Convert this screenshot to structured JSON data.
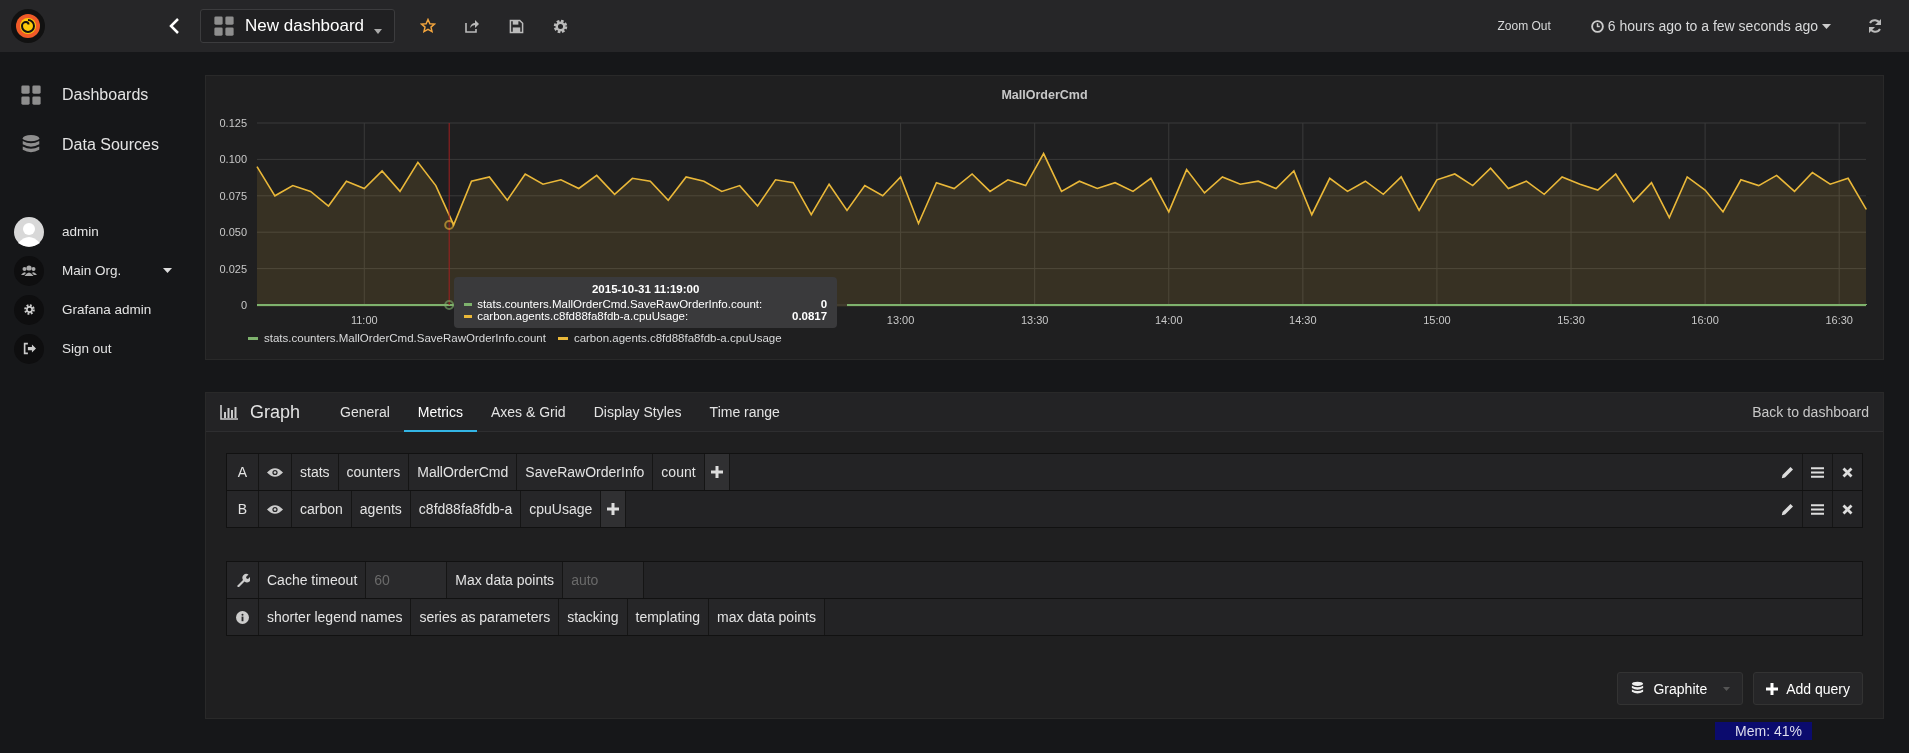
{
  "top_bar": {
    "dashboard_title": "New dashboard",
    "zoom_out": "Zoom Out",
    "time_range": "6 hours ago to a few seconds ago"
  },
  "sidebar": {
    "nav": [
      {
        "label": "Dashboards",
        "kind": "dashboards"
      },
      {
        "label": "Data Sources",
        "kind": "datasources"
      }
    ],
    "user": [
      {
        "label": "admin",
        "kind": "avatar"
      },
      {
        "label": "Main Org.",
        "kind": "org"
      },
      {
        "label": "Grafana admin",
        "kind": "admin"
      },
      {
        "label": "Sign out",
        "kind": "signout"
      }
    ]
  },
  "panel": {
    "title": "MallOrderCmd",
    "chart_data": {
      "type": "area",
      "grid": true,
      "xlim": [
        636,
        996
      ],
      "ylim": [
        0,
        0.125
      ],
      "xticks": [
        {
          "value": 660,
          "label": "11:00"
        },
        {
          "value": 780,
          "label": "13:00"
        },
        {
          "value": 810,
          "label": "13:30"
        },
        {
          "value": 840,
          "label": "14:00"
        },
        {
          "value": 870,
          "label": "14:30"
        },
        {
          "value": 900,
          "label": "15:00"
        },
        {
          "value": 930,
          "label": "15:30"
        },
        {
          "value": 960,
          "label": "16:00"
        },
        {
          "value": 990,
          "label": "16:30"
        }
      ],
      "yticks": [
        {
          "value": 0,
          "label": "0"
        },
        {
          "value": 0.025,
          "label": "0.025"
        },
        {
          "value": 0.05,
          "label": "0.050"
        },
        {
          "value": 0.075,
          "label": "0.075"
        },
        {
          "value": 0.1,
          "label": "0.100"
        },
        {
          "value": 0.125,
          "label": "0.125"
        }
      ],
      "x": [
        636,
        640,
        644,
        648,
        652,
        656,
        660,
        664,
        668,
        672,
        676,
        680,
        684,
        688,
        692,
        696,
        700,
        704,
        708,
        712,
        716,
        720,
        724,
        728,
        732,
        736,
        740,
        744,
        748,
        752,
        756,
        760,
        764,
        768,
        772,
        776,
        780,
        784,
        788,
        792,
        796,
        800,
        804,
        808,
        812,
        816,
        820,
        824,
        828,
        832,
        836,
        840,
        844,
        848,
        852,
        856,
        860,
        864,
        868,
        872,
        876,
        880,
        884,
        888,
        892,
        896,
        900,
        904,
        908,
        912,
        916,
        920,
        924,
        928,
        932,
        936,
        940,
        944,
        948,
        952,
        956,
        960,
        964,
        968,
        972,
        976,
        980,
        984,
        988,
        992,
        996
      ],
      "series": [
        {
          "name": "stats.counters.MallOrderCmd.SaveRawOrderInfo.count",
          "color": "#7eb26d",
          "values": [
            0,
            0,
            0,
            0,
            0,
            0,
            0,
            0,
            0,
            0,
            0,
            0,
            null,
            null,
            null,
            null,
            null,
            null,
            null,
            null,
            null,
            null,
            null,
            null,
            null,
            null,
            null,
            null,
            null,
            null,
            null,
            null,
            null,
            0,
            0,
            0,
            0,
            0,
            0,
            0,
            0,
            0,
            0,
            0,
            0,
            0,
            0,
            0,
            0,
            0,
            0,
            0,
            0,
            0,
            0,
            0,
            0,
            0,
            0,
            0,
            0,
            0,
            0,
            0,
            0,
            0,
            0,
            0,
            0,
            0,
            0,
            0,
            0,
            0,
            0,
            0,
            0,
            0,
            0,
            0,
            0,
            0,
            0,
            0,
            0,
            0,
            0,
            0,
            0,
            0,
            0
          ]
        },
        {
          "name": "carbon.agents.c8fd88fa8fdb-a.cpuUsage",
          "color": "#eab839",
          "values": [
            0.095,
            0.075,
            0.082,
            0.078,
            0.068,
            0.085,
            0.08,
            0.092,
            0.078,
            0.098,
            0.082,
            0.055,
            0.085,
            0.088,
            0.072,
            0.09,
            0.083,
            0.086,
            0.08,
            0.089,
            0.076,
            0.087,
            0.085,
            0.072,
            0.088,
            0.085,
            0.078,
            0.082,
            0.068,
            0.086,
            0.084,
            0.062,
            0.083,
            0.065,
            0.082,
            0.075,
            0.088,
            0.056,
            0.084,
            0.08,
            0.09,
            0.078,
            0.086,
            0.082,
            0.104,
            0.078,
            0.085,
            0.08,
            0.084,
            0.078,
            0.087,
            0.064,
            0.093,
            0.077,
            0.088,
            0.083,
            0.085,
            0.08,
            0.092,
            0.062,
            0.087,
            0.078,
            0.085,
            0.076,
            0.088,
            0.065,
            0.086,
            0.09,
            0.082,
            0.094,
            0.08,
            0.085,
            0.076,
            0.088,
            0.083,
            0.079,
            0.09,
            0.071,
            0.084,
            0.06,
            0.088,
            0.079,
            0.064,
            0.086,
            0.082,
            0.089,
            0.078,
            0.091,
            0.083,
            0.087,
            0.066
          ]
        }
      ],
      "ref_lines": [
        {
          "axis": "x",
          "value": 679,
          "color": "#a02020"
        }
      ]
    },
    "tooltip": {
      "time": "2015-10-31 11:19:00",
      "rows": [
        {
          "name": "stats.counters.MallOrderCmd.SaveRawOrderInfo.count:",
          "value": "0"
        },
        {
          "name": "carbon.agents.c8fd88fa8fdb-a.cpuUsage:",
          "value": "0.0817"
        }
      ]
    }
  },
  "editor": {
    "title": "Graph",
    "tabs": [
      {
        "label": "General",
        "selected": false
      },
      {
        "label": "Metrics",
        "selected": true
      },
      {
        "label": "Axes & Grid",
        "selected": false
      },
      {
        "label": "Display Styles",
        "selected": false
      },
      {
        "label": "Time range",
        "selected": false
      }
    ],
    "back_link": "Back to dashboard",
    "queries": [
      {
        "ref": "A",
        "segments": [
          "stats",
          "counters",
          "MallOrderCmd",
          "SaveRawOrderInfo",
          "count"
        ]
      },
      {
        "ref": "B",
        "segments": [
          "carbon",
          "agents",
          "c8fd88fa8fdb-a",
          "cpuUsage"
        ]
      }
    ],
    "options": {
      "cache_label": "Cache timeout",
      "cache_placeholder": "60",
      "max_label": "Max data points",
      "max_placeholder": "auto"
    },
    "help": [
      "shorter legend names",
      "series as parameters",
      "stacking",
      "templating",
      "max data points"
    ],
    "datasource": "Graphite",
    "add_query": "Add query"
  },
  "mem": "Mem: 41%"
}
